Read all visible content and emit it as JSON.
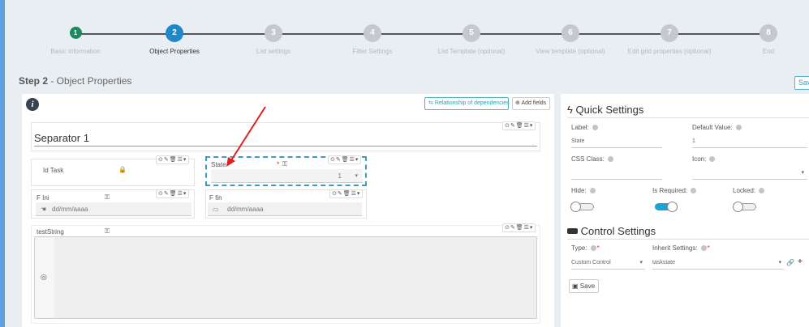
{
  "stepper": {
    "steps": [
      {
        "num": "1",
        "label": "Basic information",
        "state": "done"
      },
      {
        "num": "2",
        "label": "Object Properties",
        "state": "active"
      },
      {
        "num": "3",
        "label": "List settings",
        "state": "pending"
      },
      {
        "num": "4",
        "label": "Filter Settings",
        "state": "pending"
      },
      {
        "num": "5",
        "label": "List Template (optional)",
        "state": "pending"
      },
      {
        "num": "6",
        "label": "View template (optional)",
        "state": "pending"
      },
      {
        "num": "7",
        "label": "Edit grid properties (optional)",
        "state": "pending"
      },
      {
        "num": "8",
        "label": "End",
        "state": "pending"
      }
    ]
  },
  "page": {
    "step_prefix": "Step 2",
    "step_title": " - Object Properties",
    "save_top_label": "Sav"
  },
  "designer": {
    "relationship_button": "Relationship of dependencies",
    "add_fields_button": "Add fields",
    "separator_title": "Separator 1",
    "tools_glyphs": "⊙✎🗑☰▾",
    "fields": {
      "id_task": {
        "label": "Id Task"
      },
      "state": {
        "label": "State",
        "value": "1",
        "required_mark": "*"
      },
      "f_ini": {
        "label": "F Ini",
        "placeholder": "dd/mm/aaaa"
      },
      "f_fin": {
        "label": "F fin",
        "placeholder": "dd/mm/aaaa"
      },
      "test_string": {
        "label": "testString"
      }
    }
  },
  "quick_settings": {
    "title": "Quick Settings",
    "label_label": "Label:",
    "label_value": "State",
    "default_value_label": "Default Value:",
    "default_value": "1",
    "css_class_label": "CSS Class:",
    "css_class_value": "",
    "icon_label": "Icon:",
    "hide_label": "Hide:",
    "hide_on": false,
    "required_label": "Is Required:",
    "required_on": true,
    "locked_label": "Locked:",
    "locked_on": false
  },
  "control_settings": {
    "title": "Control Settings",
    "type_label": "Type:",
    "type_value": "Custom Control",
    "inherit_label": "Inherit Settings:",
    "inherit_value": "taskstate",
    "save_label": "Save"
  },
  "colors": {
    "accent": "#1e88c8",
    "done": "#1b8a5e",
    "pending": "#c5c9ce",
    "required": "#e0312b",
    "annotation_arrow": "#e02020"
  }
}
